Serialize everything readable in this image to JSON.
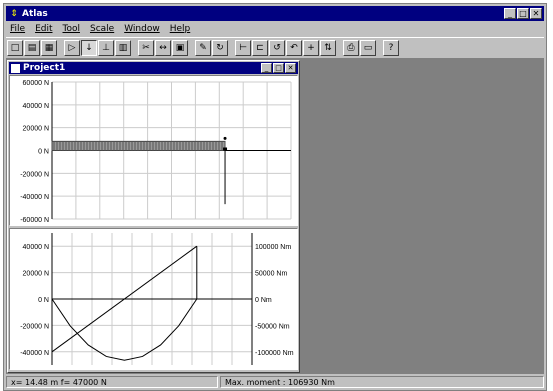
{
  "window": {
    "title": "Atlas",
    "icon": "atlas-app-icon"
  },
  "menu": [
    "File",
    "Edit",
    "Tool",
    "Scale",
    "Window",
    "Help"
  ],
  "toolbar": {
    "buttons": [
      {
        "name": "new-icon",
        "glyph": "□"
      },
      {
        "name": "open-icon",
        "glyph": "▤"
      },
      {
        "name": "save-icon",
        "glyph": "▦"
      },
      {
        "name": "select-icon",
        "glyph": "▷"
      },
      {
        "name": "point-load-icon",
        "glyph": "↓"
      },
      {
        "name": "distributed-load-icon",
        "glyph": "⊥"
      },
      {
        "name": "hatch-icon",
        "glyph": "▥"
      },
      {
        "name": "cut-icon",
        "glyph": "✂"
      },
      {
        "name": "dimension-icon",
        "glyph": "↔"
      },
      {
        "name": "grid-icon",
        "glyph": "▣"
      },
      {
        "name": "pencil-icon",
        "glyph": "✎"
      },
      {
        "name": "rotate-icon",
        "glyph": "↻"
      },
      {
        "name": "support-pin-icon",
        "glyph": "⊢"
      },
      {
        "name": "support-fixed-icon",
        "glyph": "⊏"
      },
      {
        "name": "moment-icon",
        "glyph": "↺"
      },
      {
        "name": "moment-alt-icon",
        "glyph": "↶"
      },
      {
        "name": "plus-icon",
        "glyph": "+"
      },
      {
        "name": "axis-icon",
        "glyph": "⇅"
      },
      {
        "name": "print-icon",
        "glyph": "⎙"
      },
      {
        "name": "window-icon",
        "glyph": "▭"
      },
      {
        "name": "help-icon",
        "glyph": "?"
      }
    ],
    "pressed_index": 4
  },
  "document": {
    "title": "Project1"
  },
  "chart_data": [
    {
      "type": "line",
      "title": "",
      "ylabel": "",
      "yticks": [
        "60000 N",
        "40000 N",
        "20000 N",
        "0 N",
        "-20000 N",
        "-40000 N",
        "-60000 N"
      ],
      "ylim": [
        -60000,
        60000
      ],
      "xlim": [
        0,
        20
      ],
      "grid": true,
      "beam": {
        "x_start": 0,
        "x_end": 14.48,
        "distributed_load_band_height": 8000
      },
      "reaction": {
        "x": 14.48,
        "value": -47000
      }
    },
    {
      "type": "line",
      "title": "",
      "yticks_left": [
        "40000 N",
        "20000 N",
        "0 N",
        "-20000 N",
        "-40000 N"
      ],
      "yticks_right": [
        "100000 Nm",
        "50000 Nm",
        "0 Nm",
        "-50000 Nm",
        "-100000 Nm"
      ],
      "ylim_left": [
        -50000,
        50000
      ],
      "ylim_right": [
        -125000,
        125000
      ],
      "xlim": [
        0,
        20
      ],
      "grid": true,
      "series": [
        {
          "x": [
            0,
            14.48
          ],
          "y": [
            -40000,
            40000
          ]
        },
        {
          "x": [
            0,
            1.81,
            3.62,
            5.43,
            7.24,
            9.05,
            10.86,
            12.67,
            14.48
          ],
          "y": [
            0,
            -50800,
            -87000,
            -108800,
            -116000,
            -108800,
            -87000,
            -50800,
            0
          ]
        }
      ]
    }
  ],
  "status": {
    "cursor": "x= 14.48 m  f= 47000 N",
    "moment": "Max. moment : 106930 Nm"
  }
}
